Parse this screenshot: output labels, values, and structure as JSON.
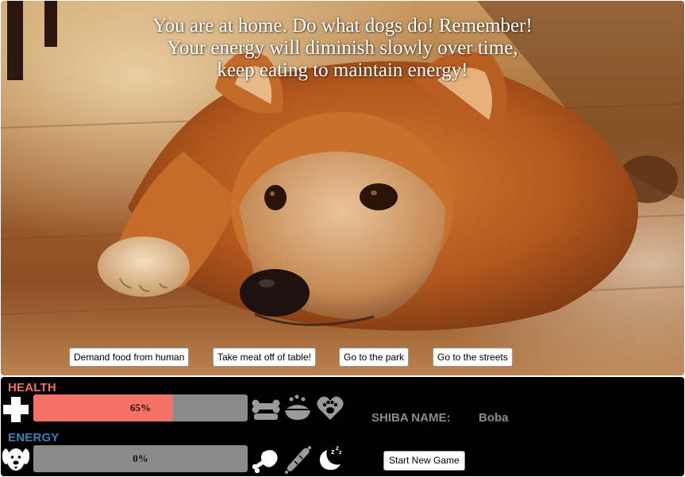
{
  "scene": {
    "message_lines": [
      "You are at home. Do what dogs do! Remember!",
      "Your energy will diminish slowly over time,",
      "keep eating to maintain energy!"
    ],
    "actions": [
      {
        "label": "Demand food from human"
      },
      {
        "label": "Take meat off of table!"
      },
      {
        "label": "Go to the park"
      },
      {
        "label": "Go to the streets"
      }
    ]
  },
  "stats": {
    "health": {
      "title": "HEALTH",
      "value": 65,
      "percent_label": "65%",
      "color": "#f37167",
      "title_color": "#f37167",
      "icon": "medical-cross-icon",
      "item_icons": [
        "bone-icon",
        "food-bowl-icon",
        "paw-heart-icon"
      ]
    },
    "energy": {
      "title": "ENERGY",
      "value": 0,
      "percent_label": "0%",
      "color": "#3a82b8",
      "title_color": "#3a82b8",
      "icon": "dog-face-icon",
      "item_icons": [
        "meat-icon",
        "sausage-icon",
        "sleep-moon-icon"
      ]
    }
  },
  "shiba": {
    "name_label": "SHIBA NAME:",
    "name": "Boba"
  },
  "controls": {
    "new_game_label": "Start New Game"
  },
  "colors": {
    "panel_bg": "#000000",
    "bar_track": "#8a8a8a",
    "icon_gray": "#9a9a9a"
  }
}
